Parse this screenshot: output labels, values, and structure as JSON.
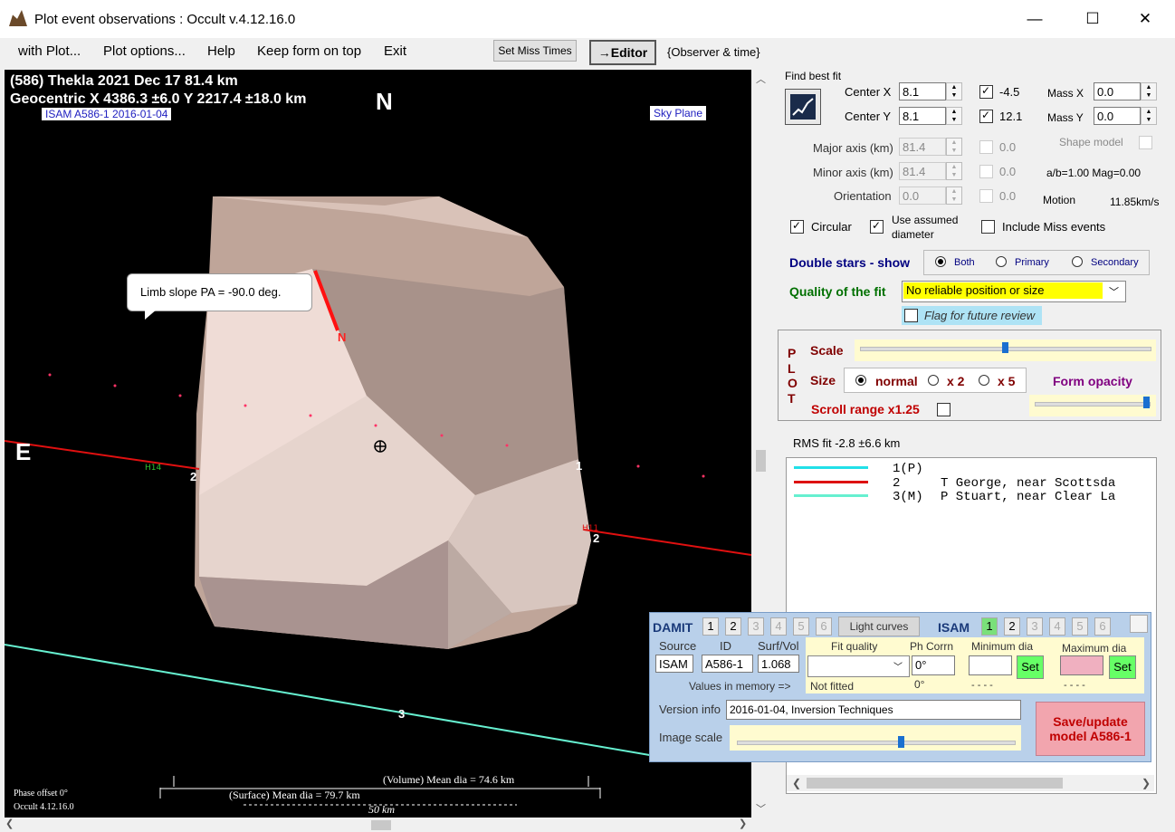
{
  "window": {
    "title": "Plot event observations : Occult v.4.12.16.0"
  },
  "menu": {
    "items": [
      "with Plot...",
      "Plot options...",
      "Help",
      "Keep form on top",
      "Exit"
    ]
  },
  "toolbar": {
    "set_miss_times": "Set Miss Times",
    "editor": "→Editor",
    "observer_time": "{Observer & time}"
  },
  "plot": {
    "header1": "(586) Thekla  2021 Dec 17   81.4 km",
    "header2": "Geocentric X 4386.3 ±6.0  Y 2217.4 ±18.0 km",
    "model_label": "ISAM A586-1 2016-01-04",
    "north": "N",
    "east": "E",
    "sky_plane": "Sky Plane",
    "limb_tip": "Limb slope PA = -90.0 deg.",
    "limb_n": "N",
    "chord_labels": [
      "1",
      "2",
      "2",
      "3"
    ],
    "volume_dia": "(Volume) Mean dia = 74.6 km",
    "surface_dia": "(Surface) Mean dia = 79.7 km",
    "scale_km": "50 km",
    "phase_offset": "Phase offset 0°",
    "version": "Occult 4.12.16.0"
  },
  "fit": {
    "find_best_fit": "Find best fit",
    "center_x_label": "Center X",
    "center_x": "8.1",
    "center_x_delta": "-4.5",
    "center_y_label": "Center Y",
    "center_y": "8.1",
    "center_y_delta": "12.1",
    "mass_x_label": "Mass X",
    "mass_x": "0.0",
    "mass_y_label": "Mass Y",
    "mass_y": "0.0",
    "major_label": "Major axis (km)",
    "major": "81.4",
    "major_delta": "0.0",
    "minor_label": "Minor axis (km)",
    "minor": "81.4",
    "minor_delta": "0.0",
    "orient_label": "Orientation",
    "orient": "0.0",
    "orient_delta": "0.0",
    "shape_model": "Shape model",
    "ab_mag": "a/b=1.00  Mag=0.00",
    "motion_label": "Motion",
    "motion": "11.85km/s",
    "circular": "Circular",
    "use_assumed_1": "Use assumed",
    "use_assumed_2": "diameter",
    "include_miss": "Include Miss events",
    "double_stars": "Double stars - show",
    "both": "Both",
    "primary": "Primary",
    "secondary": "Secondary",
    "quality_label": "Quality of the fit",
    "quality_value": "No reliable position or size",
    "flag_review": "Flag for future review"
  },
  "plotopts": {
    "side_letters": [
      "P",
      "L",
      "O",
      "T"
    ],
    "scale": "Scale",
    "size": "Size",
    "normal": "normal",
    "x2": "x 2",
    "x5": "x 5",
    "form_opacity": "Form opacity",
    "scroll_range": "Scroll range x1.25"
  },
  "rms": "RMS fit -2.8 ±6.6 km",
  "legend": {
    "rows": [
      {
        "num": "1(P)",
        "text": ""
      },
      {
        "num": "2",
        "text": "T George, near Scottsda"
      },
      {
        "num": "3(M)",
        "text": "P Stuart, near Clear La"
      }
    ],
    "colors": [
      "#22e0e8",
      "#dd1111",
      "#66f0d0"
    ]
  },
  "shape": {
    "damit": "DAMIT",
    "damit_nums": [
      "1",
      "2",
      "3",
      "4",
      "5",
      "6"
    ],
    "light_curves": "Light curves",
    "isam": "ISAM",
    "isam_nums": [
      "1",
      "2",
      "3",
      "4",
      "5",
      "6"
    ],
    "source_h": "Source",
    "id_h": "ID",
    "surf_h": "Surf/Vol",
    "source": "ISAM",
    "id": "A586-1",
    "surf": "1.068",
    "fitq_h": "Fit quality",
    "phcorr_h": "Ph Corrn",
    "mindia_h": "Minimum dia",
    "maxdia_h": "Maximum dia",
    "phcorr": "0°",
    "values_mem": "Values in memory =>",
    "not_fitted": "Not fitted",
    "mem_ph": "0°",
    "dash1": "- - - -",
    "dash2": "- - - -",
    "set": "Set",
    "version_label": "Version info",
    "version_value": "2016-01-04, Inversion Techniques",
    "image_scale": "Image scale",
    "save_1": "Save/update",
    "save_2": "model A586-1"
  }
}
